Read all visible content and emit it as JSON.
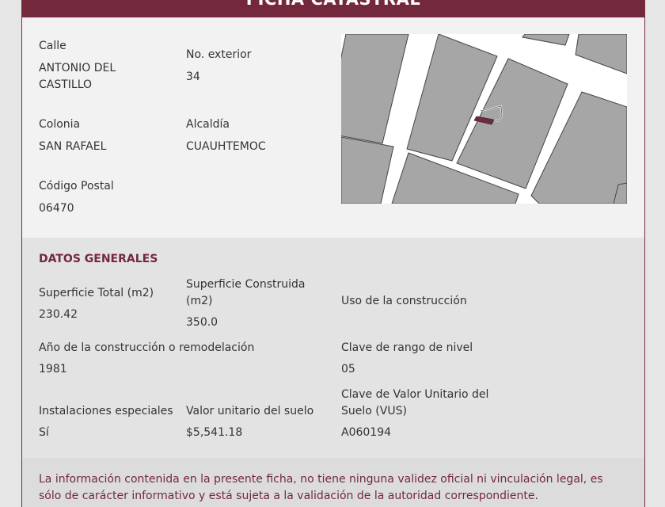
{
  "header": {
    "title": "FICHA CATASTRAL"
  },
  "location": {
    "calle_label": "Calle",
    "calle_value": "ANTONIO DEL CASTILLO",
    "no_exterior_label": "No. exterior",
    "no_exterior_value": "34",
    "colonia_label": "Colonia",
    "colonia_value": "SAN RAFAEL",
    "alcaldia_label": "Alcaldía",
    "alcaldia_value": "CUAUHTEMOC",
    "cp_label": "Código Postal",
    "cp_value": "06470"
  },
  "map": {
    "block_color": "#a6a6a6",
    "street_color": "#ffffff",
    "highlight_color": "#74283c"
  },
  "datos": {
    "title": "DATOS GENERALES",
    "superficie_total_label": "Superficie Total (m2)",
    "superficie_total_value": "230.42",
    "superficie_construida_label": "Superficie Construida (m2)",
    "superficie_construida_value": "350.0",
    "uso_label": "Uso de la construcción",
    "anio_label": "Año de la construcción o remodelación",
    "anio_value": "1981",
    "clave_rango_label": "Clave de rango de nivel",
    "clave_rango_value": "05",
    "instalaciones_label": "Instalaciones especiales",
    "instalaciones_value": "Sí",
    "valor_unitario_label": "Valor unitario del suelo",
    "valor_unitario_value": "$5,541.18",
    "vus_label": "Clave de Valor Unitario del Suelo (VUS)",
    "vus_value": "A060194"
  },
  "footer": {
    "disclaimer": "La información contenida en la presente ficha, no tiene ninguna validez oficial ni vinculación legal, es sólo de carácter informativo y está sujeta a la validación de la autoridad correspondiente."
  },
  "colors": {
    "accent": "#74283c",
    "card_bg": "#f2f2f2",
    "section_bg": "#e3e3e3"
  }
}
